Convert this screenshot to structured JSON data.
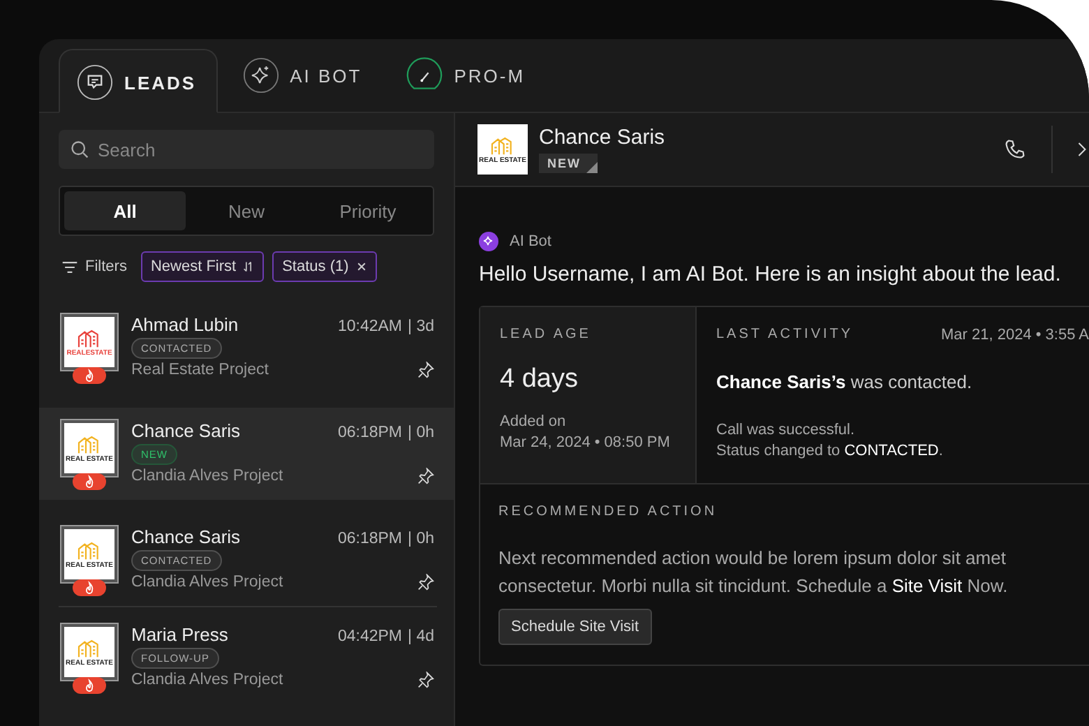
{
  "tabs": [
    {
      "kind": "leads",
      "label": "LEADS",
      "selected": true
    },
    {
      "kind": "bot",
      "label": "AI BOT",
      "selected": false
    },
    {
      "kind": "pro",
      "label": "PRO-M",
      "selected": false
    }
  ],
  "search": {
    "placeholder": "Search"
  },
  "segments": [
    {
      "label": "All",
      "selected": true
    },
    {
      "label": "New",
      "selected": false
    },
    {
      "label": "Priority",
      "selected": false
    }
  ],
  "filters": {
    "label": "Filters",
    "chips": [
      {
        "kind": "sort",
        "label": "Newest First"
      },
      {
        "kind": "clear",
        "label": "Status (1)"
      }
    ]
  },
  "leads": [
    {
      "name": "Ahmad Lubin",
      "time": "10:42AM",
      "age": "| 3d",
      "status": {
        "label": "CONTACTED",
        "color": "#aaaaaa"
      },
      "project": "Real Estate Project",
      "logo": {
        "text": "REALESTATE",
        "color": "#e8413b"
      },
      "selected": false,
      "divider": false
    },
    {
      "name": "Chance Saris",
      "time": "06:18PM",
      "age": "| 0h",
      "status": {
        "label": "NEW",
        "color": "#2fc06a"
      },
      "project": "Clandia Alves Project",
      "logo": {
        "text": "REAL ESTATE",
        "color": "#f2b21f"
      },
      "selected": true,
      "divider": false
    },
    {
      "name": "Chance Saris",
      "time": "06:18PM",
      "age": "| 0h",
      "status": {
        "label": "CONTACTED",
        "color": "#aaaaaa"
      },
      "project": "Clandia Alves Project",
      "logo": {
        "text": "REAL ESTATE",
        "color": "#f2b21f"
      },
      "selected": false,
      "divider": true
    },
    {
      "name": "Maria Press",
      "time": "04:42PM",
      "age": "| 4d",
      "status": {
        "label": "FOLLOW-UP",
        "color": "#aaaaaa"
      },
      "project": "Clandia Alves Project",
      "logo": {
        "text": "REAL ESTATE",
        "color": "#f2b21f"
      },
      "selected": false,
      "divider": false
    }
  ],
  "detail": {
    "name": "Chance Saris",
    "status": "NEW",
    "logo": {
      "text": "REAL ESTATE",
      "color": "#f2b21f"
    },
    "bot_label": "AI Bot",
    "message": "Hello Username, I am AI Bot. Here is an insight about the lead.",
    "lead_age": {
      "label": "LEAD AGE",
      "value": "4 days",
      "added_label": "Added on",
      "added_date": "Mar 24, 2024 • 08:50 PM"
    },
    "last_activity": {
      "label": "LAST ACTIVITY",
      "date": "Mar 21, 2024 • 3:55 A",
      "headline": "**Chance Saris’s** was contacted.",
      "lines": [
        "Call was successful.",
        "Status changed to **CONTACTED**."
      ]
    },
    "recommended": {
      "label": "RECOMMENDED ACTION",
      "text": "Next recommended action would be lorem ipsum dolor sit amet consectetur. Morbi nulla sit tincidunt. Schedule a **Site Visit** Now.",
      "button": "Schedule Site Visit"
    }
  }
}
